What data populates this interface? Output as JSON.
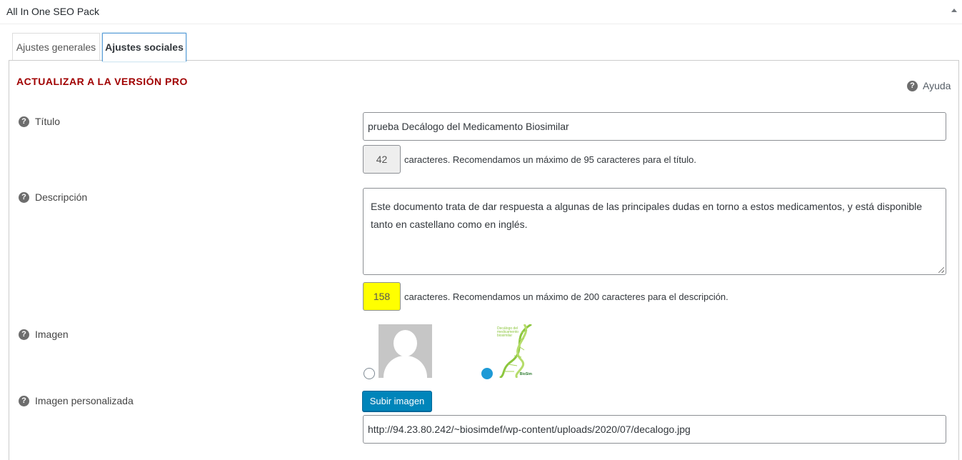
{
  "metabox": {
    "title": "All In One SEO Pack"
  },
  "tabs": [
    {
      "label": "Ajustes generales",
      "active": false
    },
    {
      "label": "Ajustes sociales",
      "active": true
    }
  ],
  "upgrade_link": "ACTUALIZAR A LA VERSIÓN PRO",
  "help_label": "Ayuda",
  "fields": {
    "title": {
      "label": "Título",
      "value": "prueba Decálogo del Medicamento Biosimilar",
      "count": "42",
      "note": "caracteres. Recomendamos un máximo de 95 caracteres para el título."
    },
    "description": {
      "label": "Descripción",
      "value": "Este documento trata de dar respuesta a algunas de las principales dudas en torno a estos medicamentos, y está disponible tanto en castellano como en inglés.",
      "count": "158",
      "note": "caracteres. Recomendamos un máximo de 200 caracteres para el descripción."
    },
    "image": {
      "label": "Imagen",
      "options": [
        {
          "name": "default-avatar",
          "selected": false
        },
        {
          "name": "document-cover",
          "selected": true
        }
      ]
    },
    "custom_image": {
      "label": "Imagen personalizada",
      "button_label": "Subir imagen",
      "value": "http://94.23.80.242/~biosimdef/wp-content/uploads/2020/07/decalogo.jpg"
    }
  },
  "thumbnail": {
    "caption": "Decálogo del medicamento biosimilar",
    "brand": "BioSim"
  },
  "colors": {
    "upgrade_text": "#a00000",
    "primary_button": "#0085ba",
    "warning_counter": "#ffff00",
    "radio_checked": "#1e9ad6"
  }
}
